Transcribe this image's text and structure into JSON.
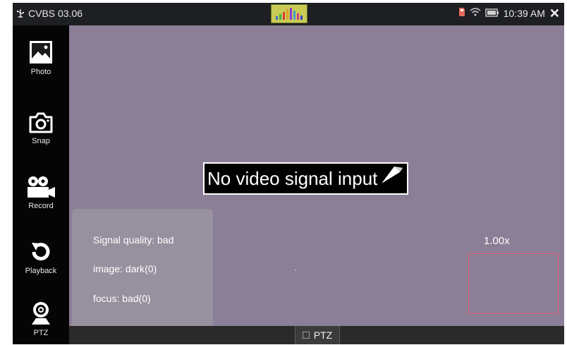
{
  "status_bar": {
    "title": "CVBS 03.06",
    "time": "10:39 AM",
    "close_symbol": "✕",
    "icons": [
      "usb-icon",
      "signal-meter-icon",
      "sd-card-icon",
      "wifi-icon",
      "battery-icon",
      "close-icon"
    ]
  },
  "sidebar": {
    "items": [
      {
        "label": "Photo",
        "icon": "photo-icon"
      },
      {
        "label": "Snap",
        "icon": "camera-icon"
      },
      {
        "label": "Record",
        "icon": "video-camera-icon"
      },
      {
        "label": "Playback",
        "icon": "playback-icon"
      },
      {
        "label": "PTZ",
        "icon": "ptz-camera-icon"
      }
    ]
  },
  "video": {
    "message": "No video signal input",
    "info": {
      "signal_quality": "Signal quality: bad",
      "image": "image: dark(0)",
      "focus": "focus: bad(0)"
    },
    "zoom": "1.00x"
  },
  "bottom_bar": {
    "ptz_label": "PTZ"
  },
  "colors": {
    "video_background": "#8a7f96",
    "zoom_box_border": "#e05a6e",
    "signal_meter": "#c8cc54"
  }
}
